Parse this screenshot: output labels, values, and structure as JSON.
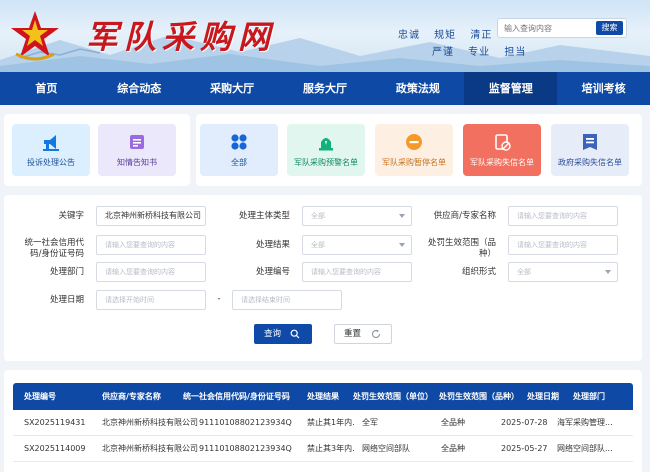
{
  "header": {
    "site_title": "军队采购网",
    "slogan_row1": "忠诚 规矩 清正",
    "slogan_row2": "严谨 专业 担当",
    "search_placeholder": "输入查询内容",
    "search_button": "搜索"
  },
  "nav": {
    "items": [
      "首页",
      "综合动态",
      "采购大厅",
      "服务大厅",
      "政策法规",
      "监督管理",
      "培训考核"
    ],
    "active": "监督管理"
  },
  "quick_links": {
    "left": [
      {
        "label": "投诉处理公告",
        "icon": "megaphone-icon"
      },
      {
        "label": "知情告知书",
        "icon": "notice-icon"
      }
    ],
    "right": [
      {
        "label": "全部",
        "icon": "grid-icon"
      },
      {
        "label": "军队采购预警名单",
        "icon": "alarm-icon"
      },
      {
        "label": "军队采购暂停名单",
        "icon": "pause-icon"
      },
      {
        "label": "军队采购失信名单",
        "icon": "blocked-document-icon"
      },
      {
        "label": "政府采购失信名单",
        "icon": "seal-icon"
      }
    ]
  },
  "filters": {
    "keyword_label": "关键字",
    "keyword_value": "北京神州新桥科技有限公司",
    "subject_type_label": "处理主体类型",
    "subject_type_value": "全部",
    "supplier_label": "供应商/专家名称",
    "supplier_placeholder": "请输入您要查询的内容",
    "credit_code_label_1": "统一社会信用代",
    "credit_code_label_2": "码/身份证号码",
    "credit_code_placeholder": "请输入您要查询的内容",
    "result_label": "处理结果",
    "result_value": "全部",
    "scope_label_1": "处罚生效范围（品",
    "scope_label_2": "种）",
    "scope_placeholder": "请输入您要查询的内容",
    "department_label": "处理部门",
    "department_placeholder": "请输入您要查询的内容",
    "number_label": "处理编号",
    "number_placeholder": "请输入您要查询的内容",
    "org_form_label": "组织形式",
    "org_form_value": "全部",
    "date_label": "处理日期",
    "date_start_placeholder": "请选择开始时间",
    "date_separator": "-",
    "date_end_placeholder": "请选择结束时间",
    "query_button": "查询",
    "reset_button": "重置"
  },
  "table": {
    "columns": [
      "处理编号",
      "供应商/专家名称",
      "统一社会信用代码/身份证号码",
      "处理结果",
      "处罚生效范围（单位）",
      "处罚生效范围（品种）",
      "处理日期",
      "处理部门"
    ],
    "rows": [
      [
        "SX2025119431",
        "北京神州新桥科技有限公司",
        "91110108802123934Q",
        "禁止其1年内...",
        "全军",
        "全品种",
        "2025-07-28",
        "海军采购管理..."
      ],
      [
        "SX2025114009",
        "北京神州新桥科技有限公司",
        "91110108802123934Q",
        "禁止其3年内...",
        "网络空间部队",
        "全品种",
        "2025-05-27",
        "网络空间部队..."
      ]
    ]
  },
  "colors": {
    "primary": "#0e4aa5",
    "title_red": "#c8181d",
    "page_bg": "#f0f3f8"
  }
}
